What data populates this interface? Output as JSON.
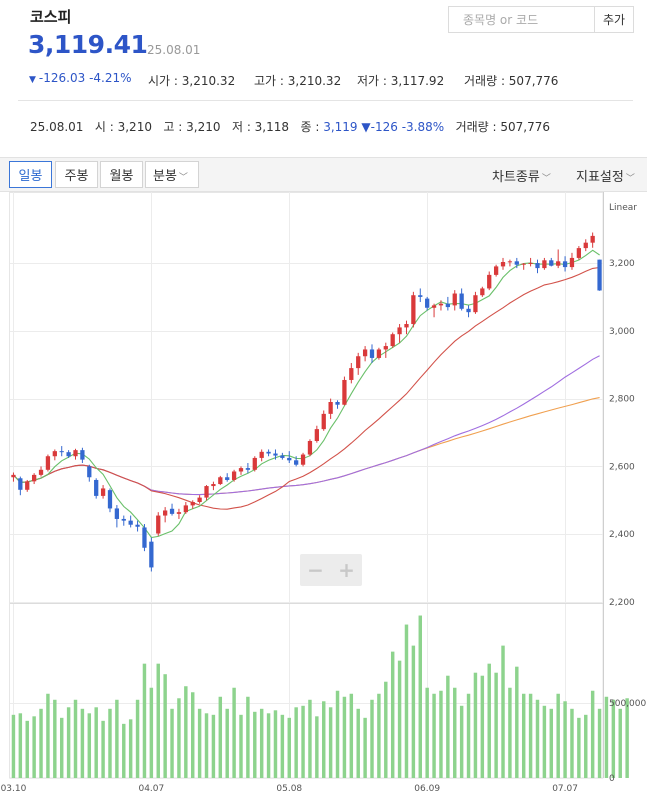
{
  "header": {
    "index_name": "코스피",
    "price": "3,119.41",
    "date": "25.08.01",
    "change": "-126.03",
    "change_pct": "-4.21%",
    "open_label": "시가",
    "open": "3,210.32",
    "high_label": "고가",
    "high": "3,210.32",
    "low_label": "저가",
    "low": "3,117.92",
    "volume_label": "거래량",
    "volume": "507,776"
  },
  "search": {
    "placeholder": "종목명 or 코드",
    "add_label": "추가"
  },
  "ohlc_line": {
    "date": "25.08.01",
    "o_label": "시",
    "o": "3,210",
    "h_label": "고",
    "h": "3,210",
    "l_label": "저",
    "l": "3,118",
    "c_label": "종",
    "c": "3,119",
    "chg": "-126",
    "chg_pct": "-3.88%",
    "vol_label": "거래량",
    "vol": "507,776"
  },
  "toolbar": {
    "periods": [
      "일봉",
      "주봉",
      "월봉",
      "분봉"
    ],
    "chart_type_label": "차트종류",
    "indicator_label": "지표설정"
  },
  "colors": {
    "up": "#d9393a",
    "down": "#3468d0",
    "volume": "#8dd38d",
    "ma5": "#6ac06a",
    "ma20": "#d2524a",
    "ma60": "#a06ee0",
    "ma120": "#f0a050"
  },
  "chart_data": {
    "type": "candlestick",
    "scale_label": "Linear",
    "price_ticks": [
      "3,200",
      "3,000",
      "2,800",
      "2,600",
      "2,400",
      "2,200"
    ],
    "price_ylim": [
      2200,
      3380
    ],
    "volume_ticks": [
      "500,000",
      "0"
    ],
    "volume_ylim": [
      0,
      1150000
    ],
    "x_ticks": [
      "03.10",
      "04.07",
      "05.08",
      "06.09",
      "07.07"
    ],
    "x_tick_index": [
      0,
      20,
      40,
      60,
      80
    ],
    "candles": [
      [
        2568,
        2582,
        2555,
        2575
      ],
      [
        2565,
        2570,
        2515,
        2531
      ],
      [
        2531,
        2560,
        2525,
        2556
      ],
      [
        2556,
        2580,
        2548,
        2575
      ],
      [
        2575,
        2600,
        2570,
        2590
      ],
      [
        2590,
        2635,
        2585,
        2630
      ],
      [
        2630,
        2650,
        2618,
        2645
      ],
      [
        2645,
        2660,
        2630,
        2642
      ],
      [
        2642,
        2648,
        2625,
        2630
      ],
      [
        2630,
        2652,
        2620,
        2648
      ],
      [
        2648,
        2655,
        2610,
        2620
      ],
      [
        2600,
        2605,
        2555,
        2568
      ],
      [
        2560,
        2565,
        2505,
        2513
      ],
      [
        2513,
        2545,
        2505,
        2535
      ],
      [
        2530,
        2535,
        2465,
        2476
      ],
      [
        2476,
        2486,
        2420,
        2445
      ],
      [
        2445,
        2455,
        2425,
        2440
      ],
      [
        2440,
        2455,
        2420,
        2428
      ],
      [
        2428,
        2440,
        2408,
        2422
      ],
      [
        2420,
        2430,
        2350,
        2360
      ],
      [
        2378,
        2390,
        2290,
        2302
      ],
      [
        2402,
        2465,
        2395,
        2455
      ],
      [
        2455,
        2480,
        2435,
        2470
      ],
      [
        2475,
        2490,
        2455,
        2460
      ],
      [
        2460,
        2475,
        2445,
        2465
      ],
      [
        2465,
        2495,
        2460,
        2485
      ],
      [
        2485,
        2500,
        2475,
        2495
      ],
      [
        2495,
        2515,
        2490,
        2508
      ],
      [
        2508,
        2545,
        2500,
        2542
      ],
      [
        2542,
        2555,
        2530,
        2548
      ],
      [
        2548,
        2572,
        2545,
        2568
      ],
      [
        2568,
        2580,
        2555,
        2560
      ],
      [
        2560,
        2590,
        2555,
        2585
      ],
      [
        2585,
        2600,
        2575,
        2595
      ],
      [
        2595,
        2610,
        2580,
        2590
      ],
      [
        2590,
        2630,
        2585,
        2625
      ],
      [
        2625,
        2650,
        2615,
        2643
      ],
      [
        2643,
        2650,
        2630,
        2638
      ],
      [
        2638,
        2650,
        2620,
        2632
      ],
      [
        2632,
        2640,
        2620,
        2625
      ],
      [
        2625,
        2645,
        2610,
        2618
      ],
      [
        2618,
        2630,
        2600,
        2605
      ],
      [
        2605,
        2640,
        2600,
        2635
      ],
      [
        2635,
        2680,
        2630,
        2675
      ],
      [
        2675,
        2720,
        2670,
        2710
      ],
      [
        2710,
        2765,
        2705,
        2755
      ],
      [
        2755,
        2800,
        2740,
        2790
      ],
      [
        2790,
        2795,
        2770,
        2782
      ],
      [
        2782,
        2865,
        2780,
        2855
      ],
      [
        2855,
        2905,
        2845,
        2890
      ],
      [
        2890,
        2935,
        2870,
        2925
      ],
      [
        2925,
        2955,
        2910,
        2945
      ],
      [
        2945,
        2960,
        2905,
        2920
      ],
      [
        2920,
        2950,
        2915,
        2945
      ],
      [
        2945,
        2965,
        2920,
        2955
      ],
      [
        2955,
        2995,
        2950,
        2990
      ],
      [
        2990,
        3020,
        2965,
        3010
      ],
      [
        3010,
        3030,
        2990,
        3020
      ],
      [
        3020,
        3115,
        3010,
        3105
      ],
      [
        3105,
        3125,
        3085,
        3100
      ],
      [
        3095,
        3100,
        3060,
        3068
      ],
      [
        3068,
        3080,
        3040,
        3075
      ],
      [
        3075,
        3090,
        3060,
        3080
      ],
      [
        3080,
        3100,
        3060,
        3070
      ],
      [
        3075,
        3120,
        3060,
        3110
      ],
      [
        3110,
        3125,
        3060,
        3065
      ],
      [
        3065,
        3075,
        3040,
        3055
      ],
      [
        3055,
        3115,
        3050,
        3105
      ],
      [
        3105,
        3130,
        3100,
        3125
      ],
      [
        3125,
        3175,
        3120,
        3165
      ],
      [
        3165,
        3195,
        3160,
        3190
      ],
      [
        3190,
        3215,
        3180,
        3203
      ],
      [
        3203,
        3210,
        3190,
        3205
      ],
      [
        3205,
        3215,
        3185,
        3195
      ],
      [
        3195,
        3200,
        3180,
        3198
      ],
      [
        3198,
        3215,
        3190,
        3200
      ],
      [
        3200,
        3210,
        3170,
        3185
      ],
      [
        3185,
        3215,
        3180,
        3208
      ],
      [
        3208,
        3215,
        3190,
        3192
      ],
      [
        3192,
        3240,
        3185,
        3205
      ],
      [
        3205,
        3220,
        3175,
        3188
      ],
      [
        3188,
        3230,
        3180,
        3215
      ],
      [
        3215,
        3250,
        3210,
        3244
      ],
      [
        3244,
        3270,
        3235,
        3260
      ],
      [
        3260,
        3290,
        3245,
        3280
      ],
      [
        3210,
        3210,
        3118,
        3119
      ]
    ],
    "volumes": [
      420000,
      430000,
      380000,
      410000,
      460000,
      560000,
      520000,
      400000,
      470000,
      520000,
      460000,
      430000,
      470000,
      380000,
      460000,
      520000,
      360000,
      390000,
      520000,
      760000,
      600000,
      760000,
      690000,
      460000,
      530000,
      610000,
      570000,
      460000,
      430000,
      420000,
      540000,
      460000,
      600000,
      420000,
      540000,
      440000,
      460000,
      430000,
      450000,
      420000,
      400000,
      470000,
      480000,
      520000,
      410000,
      510000,
      470000,
      580000,
      540000,
      560000,
      460000,
      400000,
      520000,
      560000,
      640000,
      840000,
      780000,
      1020000,
      880000,
      1080000,
      600000,
      560000,
      580000,
      680000,
      600000,
      480000,
      560000,
      700000,
      680000,
      760000,
      700000,
      880000,
      600000,
      740000,
      560000,
      560000,
      520000,
      480000,
      460000,
      560000,
      510000,
      460000,
      400000,
      420000,
      580000,
      460000,
      540000,
      520000,
      460000,
      530000
    ]
  }
}
